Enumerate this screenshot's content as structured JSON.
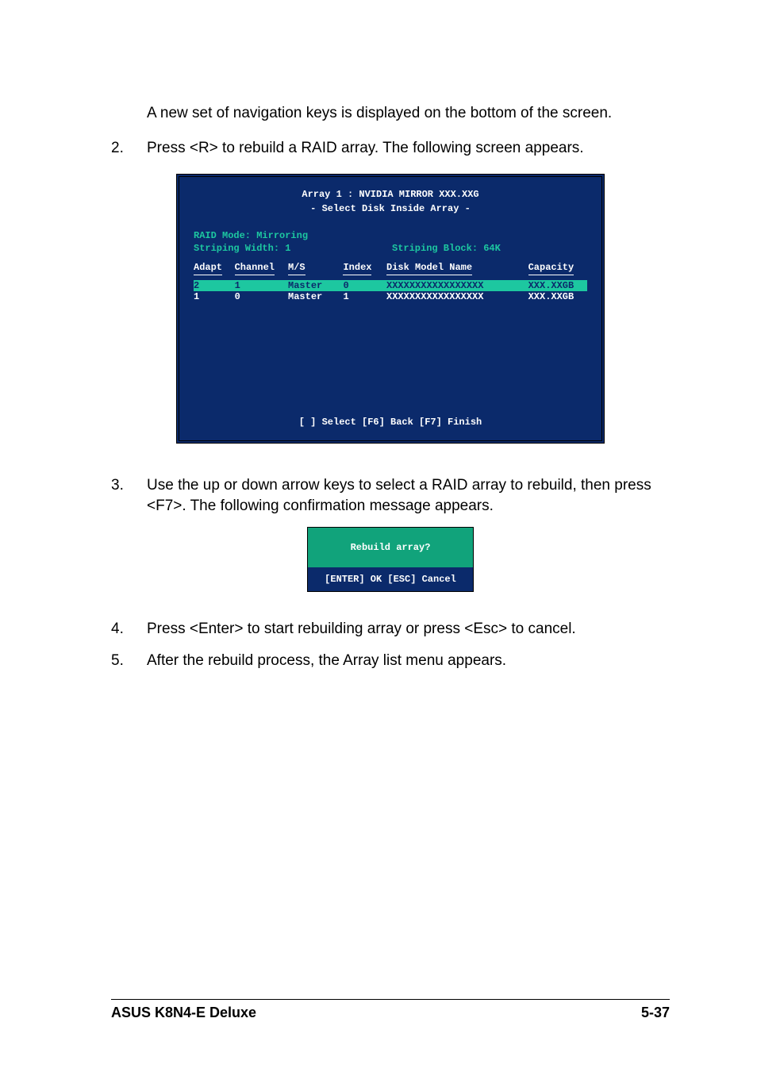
{
  "lead": "A new set of  navigation keys is displayed on the bottom of the screen.",
  "steps": {
    "s2_num": "2.",
    "s2_txt": "Press <R> to rebuild a RAID array. The following screen appears.",
    "s3_num": "3.",
    "s3_txt": "Use the up or down arrow keys to select a RAID array to rebuild, then press <F7>. The following confirmation message appears.",
    "s4_num": "4.",
    "s4_txt": "Press <Enter> to start rebuilding array or press <Esc> to cancel.",
    "s5_num": "5.",
    "s5_txt": "After the rebuild process, the Array list menu appears."
  },
  "bios": {
    "title1": "Array 1 : NVIDIA MIRROR  XXX.XXG",
    "title2": "- Select Disk Inside Array -",
    "raid_mode": "RAID Mode: Mirroring",
    "stripe_width": "Striping Width: 1",
    "stripe_block": "Striping Block: 64K",
    "headers": {
      "adapt": "Adapt",
      "channel": "Channel",
      "ms": "M/S",
      "index": "Index",
      "model": "Disk Model Name",
      "capacity": "Capacity"
    },
    "rows": [
      {
        "adapt": "2",
        "channel": "1",
        "ms": "Master",
        "index": "0",
        "model": "XXXXXXXXXXXXXXXXX",
        "capacity": "XXX.XXGB",
        "selected": true
      },
      {
        "adapt": "1",
        "channel": "0",
        "ms": "Master",
        "index": "1",
        "model": "XXXXXXXXXXXXXXXXX",
        "capacity": "XXX.XXGB",
        "selected": false
      }
    ],
    "footer": "[  ] Select [F6] Back  [F7] Finish"
  },
  "dialog": {
    "question": "Rebuild array?",
    "actions": "[ENTER] OK   [ESC] Cancel"
  },
  "page_footer": {
    "left": "ASUS K8N4-E Deluxe",
    "right": "5-37"
  }
}
